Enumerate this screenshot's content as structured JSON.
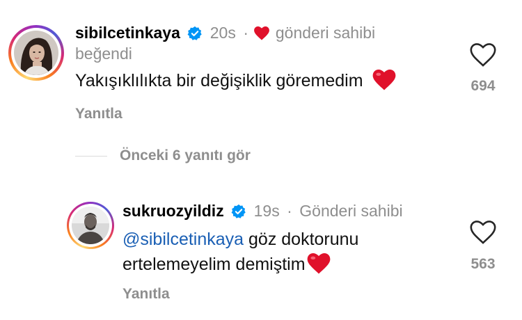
{
  "comments": [
    {
      "username": "sibilcetinkaya",
      "time": "20s",
      "separator": "·",
      "liked_by_author_line1": "gönderi sahibi",
      "liked_by_author_line2": "beğendi",
      "text": "Yakışıklılıkta bir değişiklik göremedim",
      "emoji": "❤️",
      "likes": "694",
      "reply_label": "Yanıtla"
    },
    {
      "username": "sukruozyildiz",
      "time": "19s",
      "separator": "·",
      "author_badge": "Gönderi sahibi",
      "mention": "@sibilcetinkaya",
      "text_line1_rest": " göz doktorunu",
      "text_line2": "ertelemeyelim demiştim",
      "emoji": "❤️",
      "likes": "563",
      "reply_label": "Yanıtla"
    }
  ],
  "view_replies": "Önceki 6 yanıtı gör",
  "colors": {
    "verified": "#0095f6",
    "heart": "#e0112b",
    "meta": "#8e8e8e",
    "mention": "#1a5fb4"
  },
  "icons": [
    "verified-badge-icon",
    "heart-icon",
    "like-outline-icon"
  ]
}
